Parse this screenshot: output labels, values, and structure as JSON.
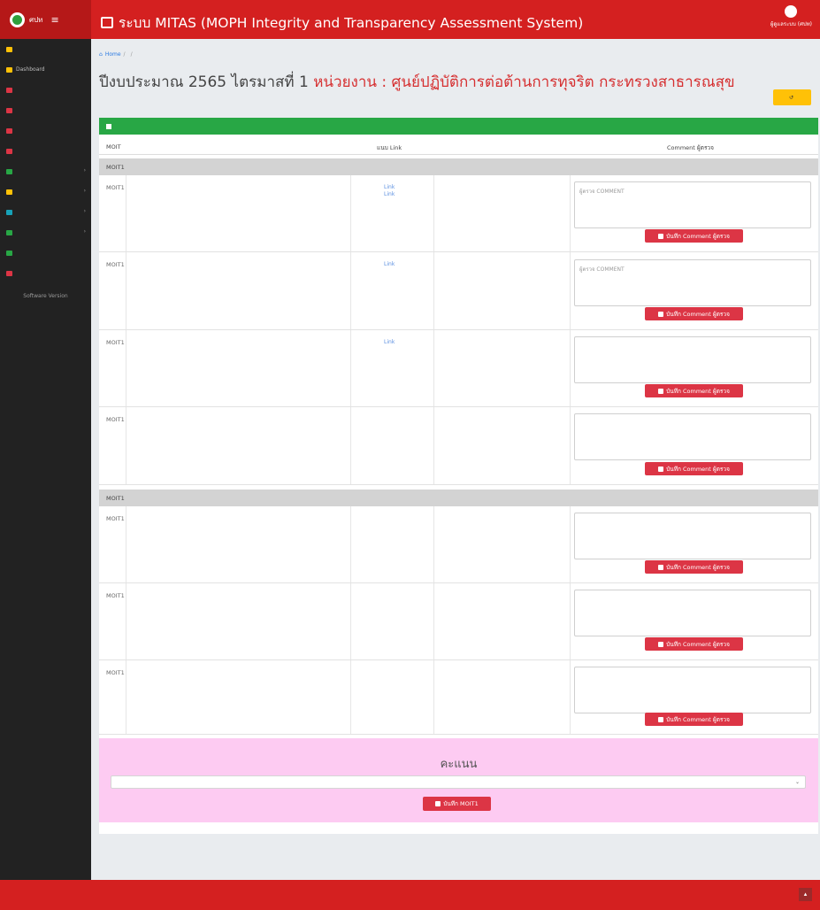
{
  "header": {
    "brand_label": "ศปท",
    "menu_toggle_glyph": "≡",
    "title": "ระบบ MITAS (MOPH Integrity and Transparency Assessment System)",
    "user_label": "ผู้ดูแลระบบ (ศปท)"
  },
  "sidebar": {
    "items": [
      {
        "label": "",
        "icon": "announcement-icon",
        "color": "#ffc107"
      },
      {
        "label": "Dashboard",
        "icon": "dashboard-icon",
        "color": "#ffc107"
      },
      {
        "label": "",
        "icon": "form-icon",
        "color": "#dc3545"
      },
      {
        "label": "",
        "icon": "check-icon",
        "color": "#dc3545"
      },
      {
        "label": "",
        "icon": "history-icon",
        "color": "#dc3545"
      },
      {
        "label": "",
        "icon": "result-icon",
        "color": "#dc3545"
      },
      {
        "label": "",
        "icon": "report-icon",
        "color": "#28a745"
      },
      {
        "label": "",
        "icon": "users-icon",
        "color": "#ffc107"
      },
      {
        "label": "",
        "icon": "settings-icon",
        "color": "#17a2b8"
      },
      {
        "label": "",
        "icon": "account-icon",
        "color": "#28a745"
      },
      {
        "label": "",
        "icon": "manual-icon",
        "color": "#28a745"
      },
      {
        "label": "",
        "icon": "logout-icon",
        "color": "#dc3545"
      }
    ],
    "version_label": "Software Version"
  },
  "breadcrumb": {
    "home": "Home",
    "parent": "",
    "current": ""
  },
  "heading": {
    "prefix": "ปีงบประมาณ 2565 ไตรมาสที่ 1",
    "unit": "หน่วยงาน : ศูนย์ปฏิบัติการต่อต้านการทุจริต กระทรวงสาธารณสุข"
  },
  "back_button_label": "",
  "notice_text": "",
  "columns": {
    "moit": "MOIT",
    "criteria": "",
    "link": "แนบ Link",
    "extra": "",
    "comment": "Comment ผู้ตรวจ"
  },
  "sections": [
    {
      "code": "MOIT1",
      "title": ""
    },
    {
      "code": "MOIT1",
      "title": ""
    }
  ],
  "rows": [
    {
      "code": "MOIT1",
      "description": "",
      "links": [
        "Link",
        "Link"
      ],
      "extra": "",
      "comment_placeholder": "ผู้ตรวจ COMMENT"
    },
    {
      "code": "MOIT1",
      "description": "",
      "links": [
        "Link"
      ],
      "extra": "",
      "comment_placeholder": "ผู้ตรวจ COMMENT"
    },
    {
      "code": "MOIT1",
      "description": "",
      "links": [
        "Link"
      ],
      "extra": "",
      "comment_placeholder": ""
    },
    {
      "code": "MOIT1",
      "description": "",
      "links": [],
      "extra": "",
      "comment_placeholder": ""
    },
    {
      "code": "MOIT1",
      "description": "",
      "links": [],
      "extra": "",
      "comment_placeholder": ""
    },
    {
      "code": "MOIT1",
      "description": "",
      "links": [],
      "extra": "",
      "comment_placeholder": ""
    },
    {
      "code": "MOIT1",
      "description": "",
      "links": [],
      "extra": "",
      "comment_placeholder": ""
    }
  ],
  "save_comment_label": "บันทึก Comment ผู้ตรวจ",
  "score": {
    "title": "คะแนน",
    "selected_option": "",
    "save_label": "บันทึก MOIT1"
  },
  "footer": {
    "line1": "",
    "line2": "",
    "line3": ""
  },
  "colors": {
    "header_red": "#d42020",
    "success_green": "#28a745",
    "warning_yellow": "#ffc107",
    "danger_red": "#dc3545",
    "score_pink": "#fdcbf2"
  }
}
